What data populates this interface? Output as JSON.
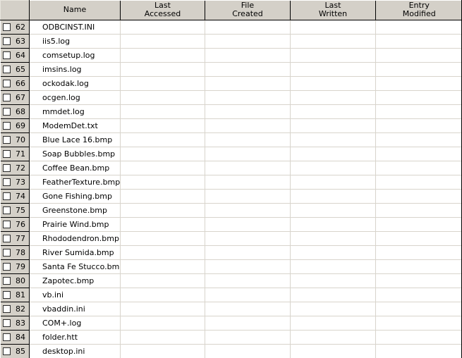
{
  "table": {
    "columns": [
      {
        "key": "num",
        "label": ""
      },
      {
        "key": "name",
        "label": "Name"
      },
      {
        "key": "accessed",
        "label_line1": "Last",
        "label_line2": "Accessed"
      },
      {
        "key": "created",
        "label_line1": "File",
        "label_line2": "Created"
      },
      {
        "key": "written",
        "label_line1": "Last",
        "label_line2": "Written"
      },
      {
        "key": "modified",
        "label_line1": "Entry",
        "label_line2": "Modified"
      }
    ],
    "colors": {
      "header_background": "#d4d0c8",
      "header_text": "#000000",
      "row_background": "#ffffff",
      "row_separator": "#d8d4cc",
      "grid_border": "#000000",
      "checkbox_fill": "#ffffff",
      "checkbox_border": "#2b2b2b"
    },
    "rows": [
      {
        "num": "62",
        "checked": false,
        "name": "ODBCINST.INI",
        "accessed": "",
        "created": "",
        "written": "",
        "modified": ""
      },
      {
        "num": "63",
        "checked": false,
        "name": "iis5.log",
        "accessed": "",
        "created": "",
        "written": "",
        "modified": ""
      },
      {
        "num": "64",
        "checked": false,
        "name": "comsetup.log",
        "accessed": "",
        "created": "",
        "written": "",
        "modified": ""
      },
      {
        "num": "65",
        "checked": false,
        "name": "imsins.log",
        "accessed": "",
        "created": "",
        "written": "",
        "modified": ""
      },
      {
        "num": "66",
        "checked": false,
        "name": "ockodak.log",
        "accessed": "",
        "created": "",
        "written": "",
        "modified": ""
      },
      {
        "num": "67",
        "checked": false,
        "name": "ocgen.log",
        "accessed": "",
        "created": "",
        "written": "",
        "modified": ""
      },
      {
        "num": "68",
        "checked": false,
        "name": "mmdet.log",
        "accessed": "",
        "created": "",
        "written": "",
        "modified": ""
      },
      {
        "num": "69",
        "checked": false,
        "name": "ModemDet.txt",
        "accessed": "",
        "created": "",
        "written": "",
        "modified": ""
      },
      {
        "num": "70",
        "checked": false,
        "name": "Blue Lace 16.bmp",
        "accessed": "",
        "created": "",
        "written": "",
        "modified": ""
      },
      {
        "num": "71",
        "checked": false,
        "name": "Soap Bubbles.bmp",
        "accessed": "",
        "created": "",
        "written": "",
        "modified": ""
      },
      {
        "num": "72",
        "checked": false,
        "name": "Coffee Bean.bmp",
        "accessed": "",
        "created": "",
        "written": "",
        "modified": ""
      },
      {
        "num": "73",
        "checked": false,
        "name": "FeatherTexture.bmp",
        "accessed": "",
        "created": "",
        "written": "",
        "modified": ""
      },
      {
        "num": "74",
        "checked": false,
        "name": "Gone Fishing.bmp",
        "accessed": "",
        "created": "",
        "written": "",
        "modified": ""
      },
      {
        "num": "75",
        "checked": false,
        "name": "Greenstone.bmp",
        "accessed": "",
        "created": "",
        "written": "",
        "modified": ""
      },
      {
        "num": "76",
        "checked": false,
        "name": "Prairie Wind.bmp",
        "accessed": "",
        "created": "",
        "written": "",
        "modified": ""
      },
      {
        "num": "77",
        "checked": false,
        "name": "Rhododendron.bmp",
        "accessed": "",
        "created": "",
        "written": "",
        "modified": ""
      },
      {
        "num": "78",
        "checked": false,
        "name": "River Sumida.bmp",
        "accessed": "",
        "created": "",
        "written": "",
        "modified": ""
      },
      {
        "num": "79",
        "checked": false,
        "name": "Santa Fe Stucco.bmp",
        "accessed": "",
        "created": "",
        "written": "",
        "modified": ""
      },
      {
        "num": "80",
        "checked": false,
        "name": "Zapotec.bmp",
        "accessed": "",
        "created": "",
        "written": "",
        "modified": ""
      },
      {
        "num": "81",
        "checked": false,
        "name": "vb.ini",
        "accessed": "",
        "created": "",
        "written": "",
        "modified": ""
      },
      {
        "num": "82",
        "checked": false,
        "name": "vbaddin.ini",
        "accessed": "",
        "created": "",
        "written": "",
        "modified": ""
      },
      {
        "num": "83",
        "checked": false,
        "name": "COM+.log",
        "accessed": "",
        "created": "",
        "written": "",
        "modified": ""
      },
      {
        "num": "84",
        "checked": false,
        "name": "folder.htt",
        "accessed": "",
        "created": "",
        "written": "",
        "modified": ""
      },
      {
        "num": "85",
        "checked": false,
        "name": "desktop.ini",
        "accessed": "",
        "created": "",
        "written": "",
        "modified": ""
      }
    ]
  }
}
